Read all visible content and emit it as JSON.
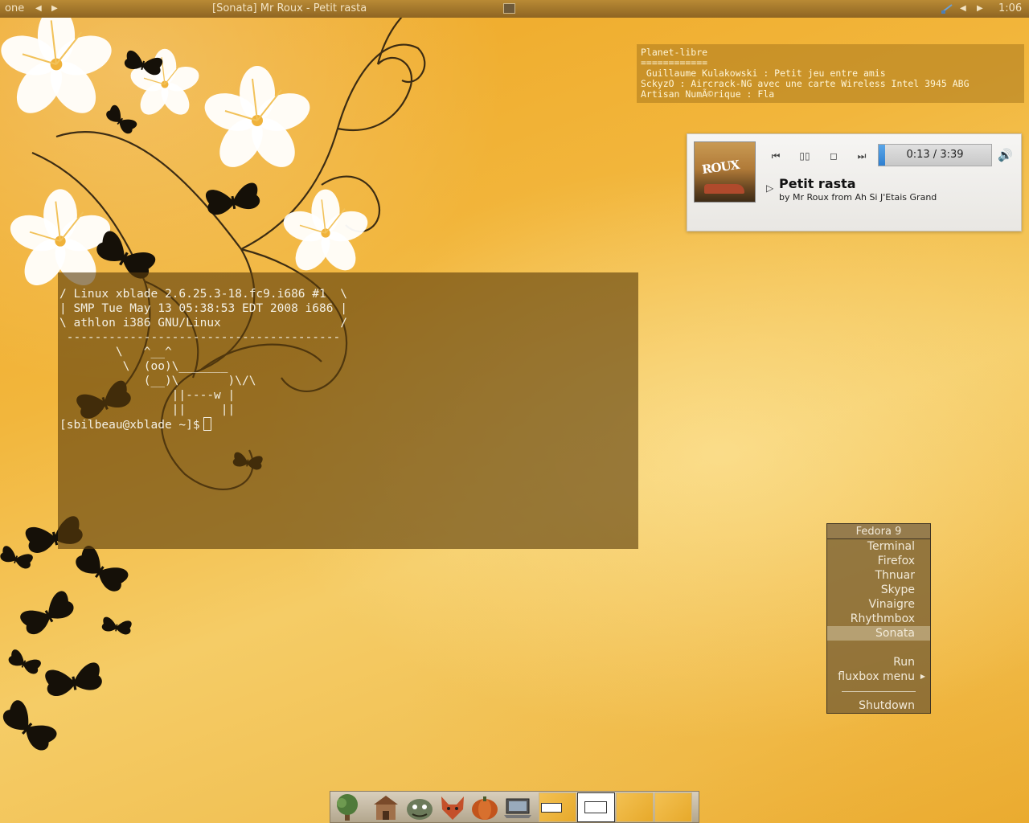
{
  "toolbar": {
    "workspace": "one",
    "window_title": "[Sonata] Mr Roux - Petit rasta",
    "clock": "1:06",
    "icons": [
      "left-arrow-icon",
      "right-arrow-icon",
      "terminal-icon",
      "network-icon"
    ]
  },
  "conky": {
    "lines": [
      "Planet-libre",
      "============",
      " Guillaume Kulakowski : Petit jeu entre amis",
      "SckyzO : Aircrack-NG avec une carte Wireless Intel 3945 ABG",
      "Artisan NumÃ©rique : Fla"
    ]
  },
  "sonata": {
    "album_art_text": "ROUX",
    "time": "0:13 / 3:39",
    "progress_fraction": 0.055,
    "song_title": "Petit rasta",
    "song_info": "by Mr Roux from Ah Si J'Etais Grand",
    "icons": [
      "previous-icon",
      "pause-icon",
      "stop-icon",
      "next-icon",
      "volume-icon"
    ]
  },
  "terminal": {
    "lines": [
      "/ Linux xblade 2.6.25.3-18.fc9.i686 #1  \\",
      "| SMP Tue May 13 05:38:53 EDT 2008 i686 |",
      "\\ athlon i386 GNU/Linux                 /",
      " ---------------------------------------",
      "        \\   ^__^",
      "         \\  (oo)\\_______",
      "            (__)\\       )\\/\\",
      "                ||----w |",
      "                ||     ||"
    ],
    "prompt": "[sbilbeau@xblade ~]$"
  },
  "fluxbox_menu": {
    "title": "Fedora 9",
    "items": [
      "Terminal",
      "Firefox",
      "Thnuar",
      "Skype",
      "Vinaigre",
      "Rhythmbox",
      "Sonata"
    ],
    "active_item": "Sonata",
    "run": "Run",
    "submenu": "fluxbox menu",
    "shutdown": "Shutdown"
  },
  "dock": {
    "icons": [
      "tree-icon",
      "house-icon",
      "monster-icon",
      "fox-icon",
      "pumpkin-icon",
      "laptop-icon"
    ],
    "pager_count": 4,
    "current_workspace": 2
  }
}
